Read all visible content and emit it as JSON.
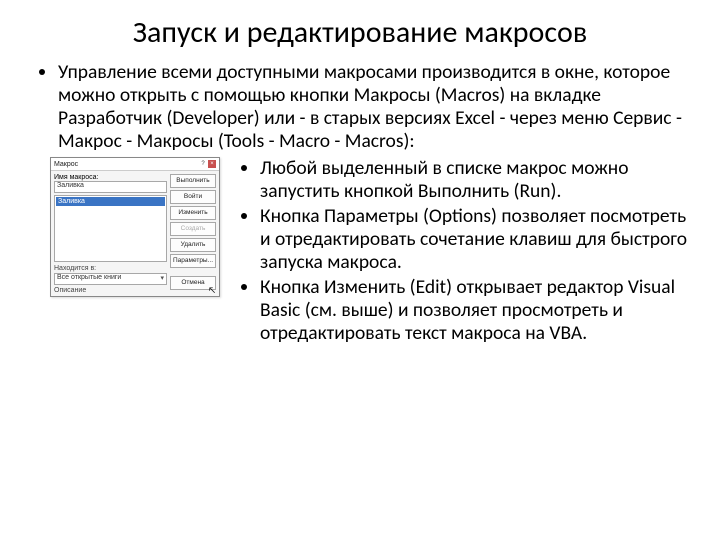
{
  "title": "Запуск и редактирование макросов",
  "intro": "Управление всеми доступными макросами производится в окне, которое можно открыть с помощью кнопки Макросы (Macros) на вкладке Разработчик (Developer) или - в старых версиях Excel - через меню Сервис - Макрос - Макросы (Tools - Macro - Macros):",
  "bullets": [
    "Любой выделенный в списке макрос можно запустить кнопкой Выполнить (Run).",
    "Кнопка Параметры (Options) позволяет посмотреть и отредактировать сочетание клавиш для быстрого запуска макроса.",
    "Кнопка Изменить (Edit) открывает редактор Visual Basic (см. выше) и позволяет просмотреть и отредактировать текст макроса на VBA."
  ],
  "dialog": {
    "title": "Макрос",
    "name_label": "Имя макроса:",
    "name_value": "Заливка",
    "list_selected": "Заливка",
    "location_label": "Находится в:",
    "location_value": "Все открытые книги",
    "desc_label": "Описание",
    "buttons": {
      "run": "Выполнить",
      "step": "Войти",
      "edit": "Изменить",
      "create": "Создать",
      "delete": "Удалить",
      "options": "Параметры...",
      "cancel": "Отмена"
    }
  }
}
